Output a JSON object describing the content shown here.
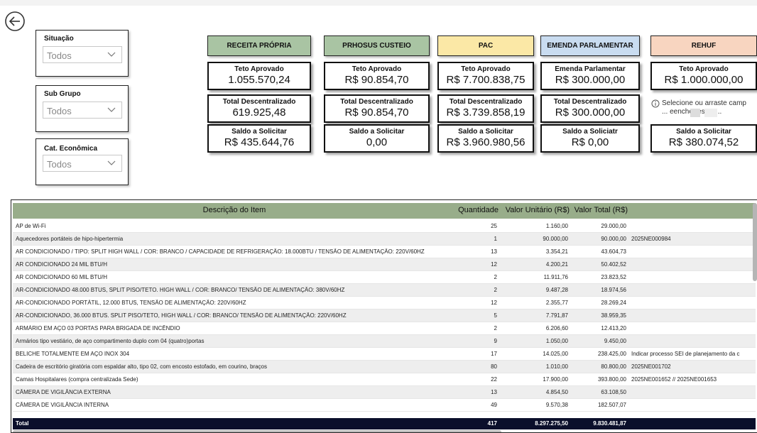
{
  "nav": {
    "back_icon": "arrow-left-circle-icon"
  },
  "filters": [
    {
      "label": "Situação",
      "value": "Todos"
    },
    {
      "label": "Sub Grupo",
      "value": "Todos"
    },
    {
      "label": "Cat. Econômica",
      "value": "Todos"
    }
  ],
  "columns": [
    {
      "header": "RECEITA PRÓPRIA",
      "header_color": "#a9c4a3",
      "cards": [
        {
          "title": "Teto Aprovado",
          "value": "1.055.570,24"
        },
        {
          "title": "Total Descentralizado",
          "value": "619.925,48"
        },
        {
          "title": "Saldo a Solicitar",
          "value": "R$ 435.644,76"
        }
      ]
    },
    {
      "header": "PRHOSUS CUSTEIO",
      "header_color": "#a9c4a3",
      "cards": [
        {
          "title": "Teto Aprovado",
          "value": "R$ 90.854,70"
        },
        {
          "title": "Total Descentralizado",
          "value": "R$ 90.854,70"
        },
        {
          "title": "Saldo a Solicitar",
          "value": "0,00"
        }
      ]
    },
    {
      "header": "PAC",
      "header_color": "#fbe8a6",
      "cards": [
        {
          "title": "Teto Aprovado",
          "value": "R$ 7.700.838,75"
        },
        {
          "title": "Total Descentralizado",
          "value": "R$ 3.739.858,19"
        },
        {
          "title": "Saldo a Solicitar",
          "value": "R$ 3.960.980,56"
        }
      ]
    },
    {
      "header": "EMENDA PARLAMENTAR",
      "header_color": "#c9dcf0",
      "cards": [
        {
          "title": "Emenda Parlamentar",
          "value": "R$ 300.000,00"
        },
        {
          "title": "Total Descentralizado",
          "value": "R$ 300.000,00"
        },
        {
          "title": "Saldo a Soliciatr",
          "value": "R$ 0,00"
        }
      ]
    },
    {
      "header": "REHUF",
      "header_color": "#f8d5c0",
      "cards": [
        {
          "title": "Teto Aprovado",
          "value": "R$ 1.000.000,00"
        },
        {
          "title": "Saldo a Solicitar",
          "value": "R$ 380.074,52"
        }
      ]
    }
  ],
  "tooltip": {
    "icon": "info-icon",
    "text": "Selecione ou arraste camp ... eencher este v..."
  },
  "table": {
    "headers": [
      "Descrição do Item",
      "Quantidade",
      "Valor Unitário (R$)",
      "Valor Total (R$)",
      ""
    ],
    "rows": [
      [
        "AP de Wi-Fi",
        "25",
        "1.160,00",
        "29.000,00",
        ""
      ],
      [
        "Aquecedores portáteis de hipo-hipertermia",
        "1",
        "90.000,00",
        "90.000,00",
        "2025NE000984"
      ],
      [
        "AR CONDICIONADO / TIPO: SPLIT HIGH WALL / COR: BRANCO / CAPACIDADE DE REFRIGERAÇÃO: 18.000BTU / TENSÃO DE ALIMENTAÇÃO: 220V/60HZ",
        "13",
        "3.354,21",
        "43.604,73",
        ""
      ],
      [
        "AR CONDICIONADO 24 MIL BTU/H",
        "12",
        "4.200,21",
        "50.402,52",
        ""
      ],
      [
        "AR CONDICIONADO 60 MIL BTU/H",
        "2",
        "11.911,76",
        "23.823,52",
        ""
      ],
      [
        "AR-CONDICIONADO 48.000 BTUS, SPLIT PISO/TETO. HIGH WALL / COR: BRANCO/ TENSÃO DE ALIMENTAÇÃO: 380V/60HZ",
        "2",
        "9.487,28",
        "18.974,56",
        ""
      ],
      [
        "AR-CONDICIONADO PORTÁTIL, 12.000 BTUS, TENSÃO DE ALIMENTAÇÃO: 220V/60HZ",
        "12",
        "2.355,77",
        "28.269,24",
        ""
      ],
      [
        "AR-CONDICIONADO, 36.000 BTUS. SPLIT PISO/TETO, HIGH WALL / COR: BRANCO/ TENSÃO DE ALIMENTAÇÃO: 220V/60HZ",
        "5",
        "7.791,87",
        "38.959,35",
        ""
      ],
      [
        "ARMÁRIO EM AÇO 03 PORTAS PARA BRIGADA DE INCÊNDIO",
        "2",
        "6.206,60",
        "12.413,20",
        ""
      ],
      [
        "Armários tipo vestiário, de aço compartimento duplo com 04 (quatro)portas",
        "9",
        "1.050,00",
        "9.450,00",
        ""
      ],
      [
        "BELICHE TOTALMENTE EM AÇO INOX 304",
        "17",
        "14.025,00",
        "238.425,00",
        "Indicar processo SEI de planejamento da c"
      ],
      [
        "Cadeira de escritório giratória com espaldar alto, tipo 02, com encosto estofado, em courino, braços",
        "80",
        "1.010,00",
        "80.800,00",
        "2025NE001702"
      ],
      [
        "Camas Hospitalares (compra centralizada Sede)",
        "22",
        "17.900,00",
        "393.800,00",
        "2025NE001652 // 2025NE001653"
      ],
      [
        "CÂMERA DE VIGILÂNCIA EXTERNA",
        "13",
        "4.854,50",
        "63.108,50",
        ""
      ],
      [
        "CÂMERA DE VIGILÂNCIA INTERNA",
        "49",
        "9.570,38",
        "182.507,07",
        ""
      ]
    ],
    "total": [
      "Total",
      "417",
      "8.297.275,50",
      "9.830.481,87",
      ""
    ]
  }
}
